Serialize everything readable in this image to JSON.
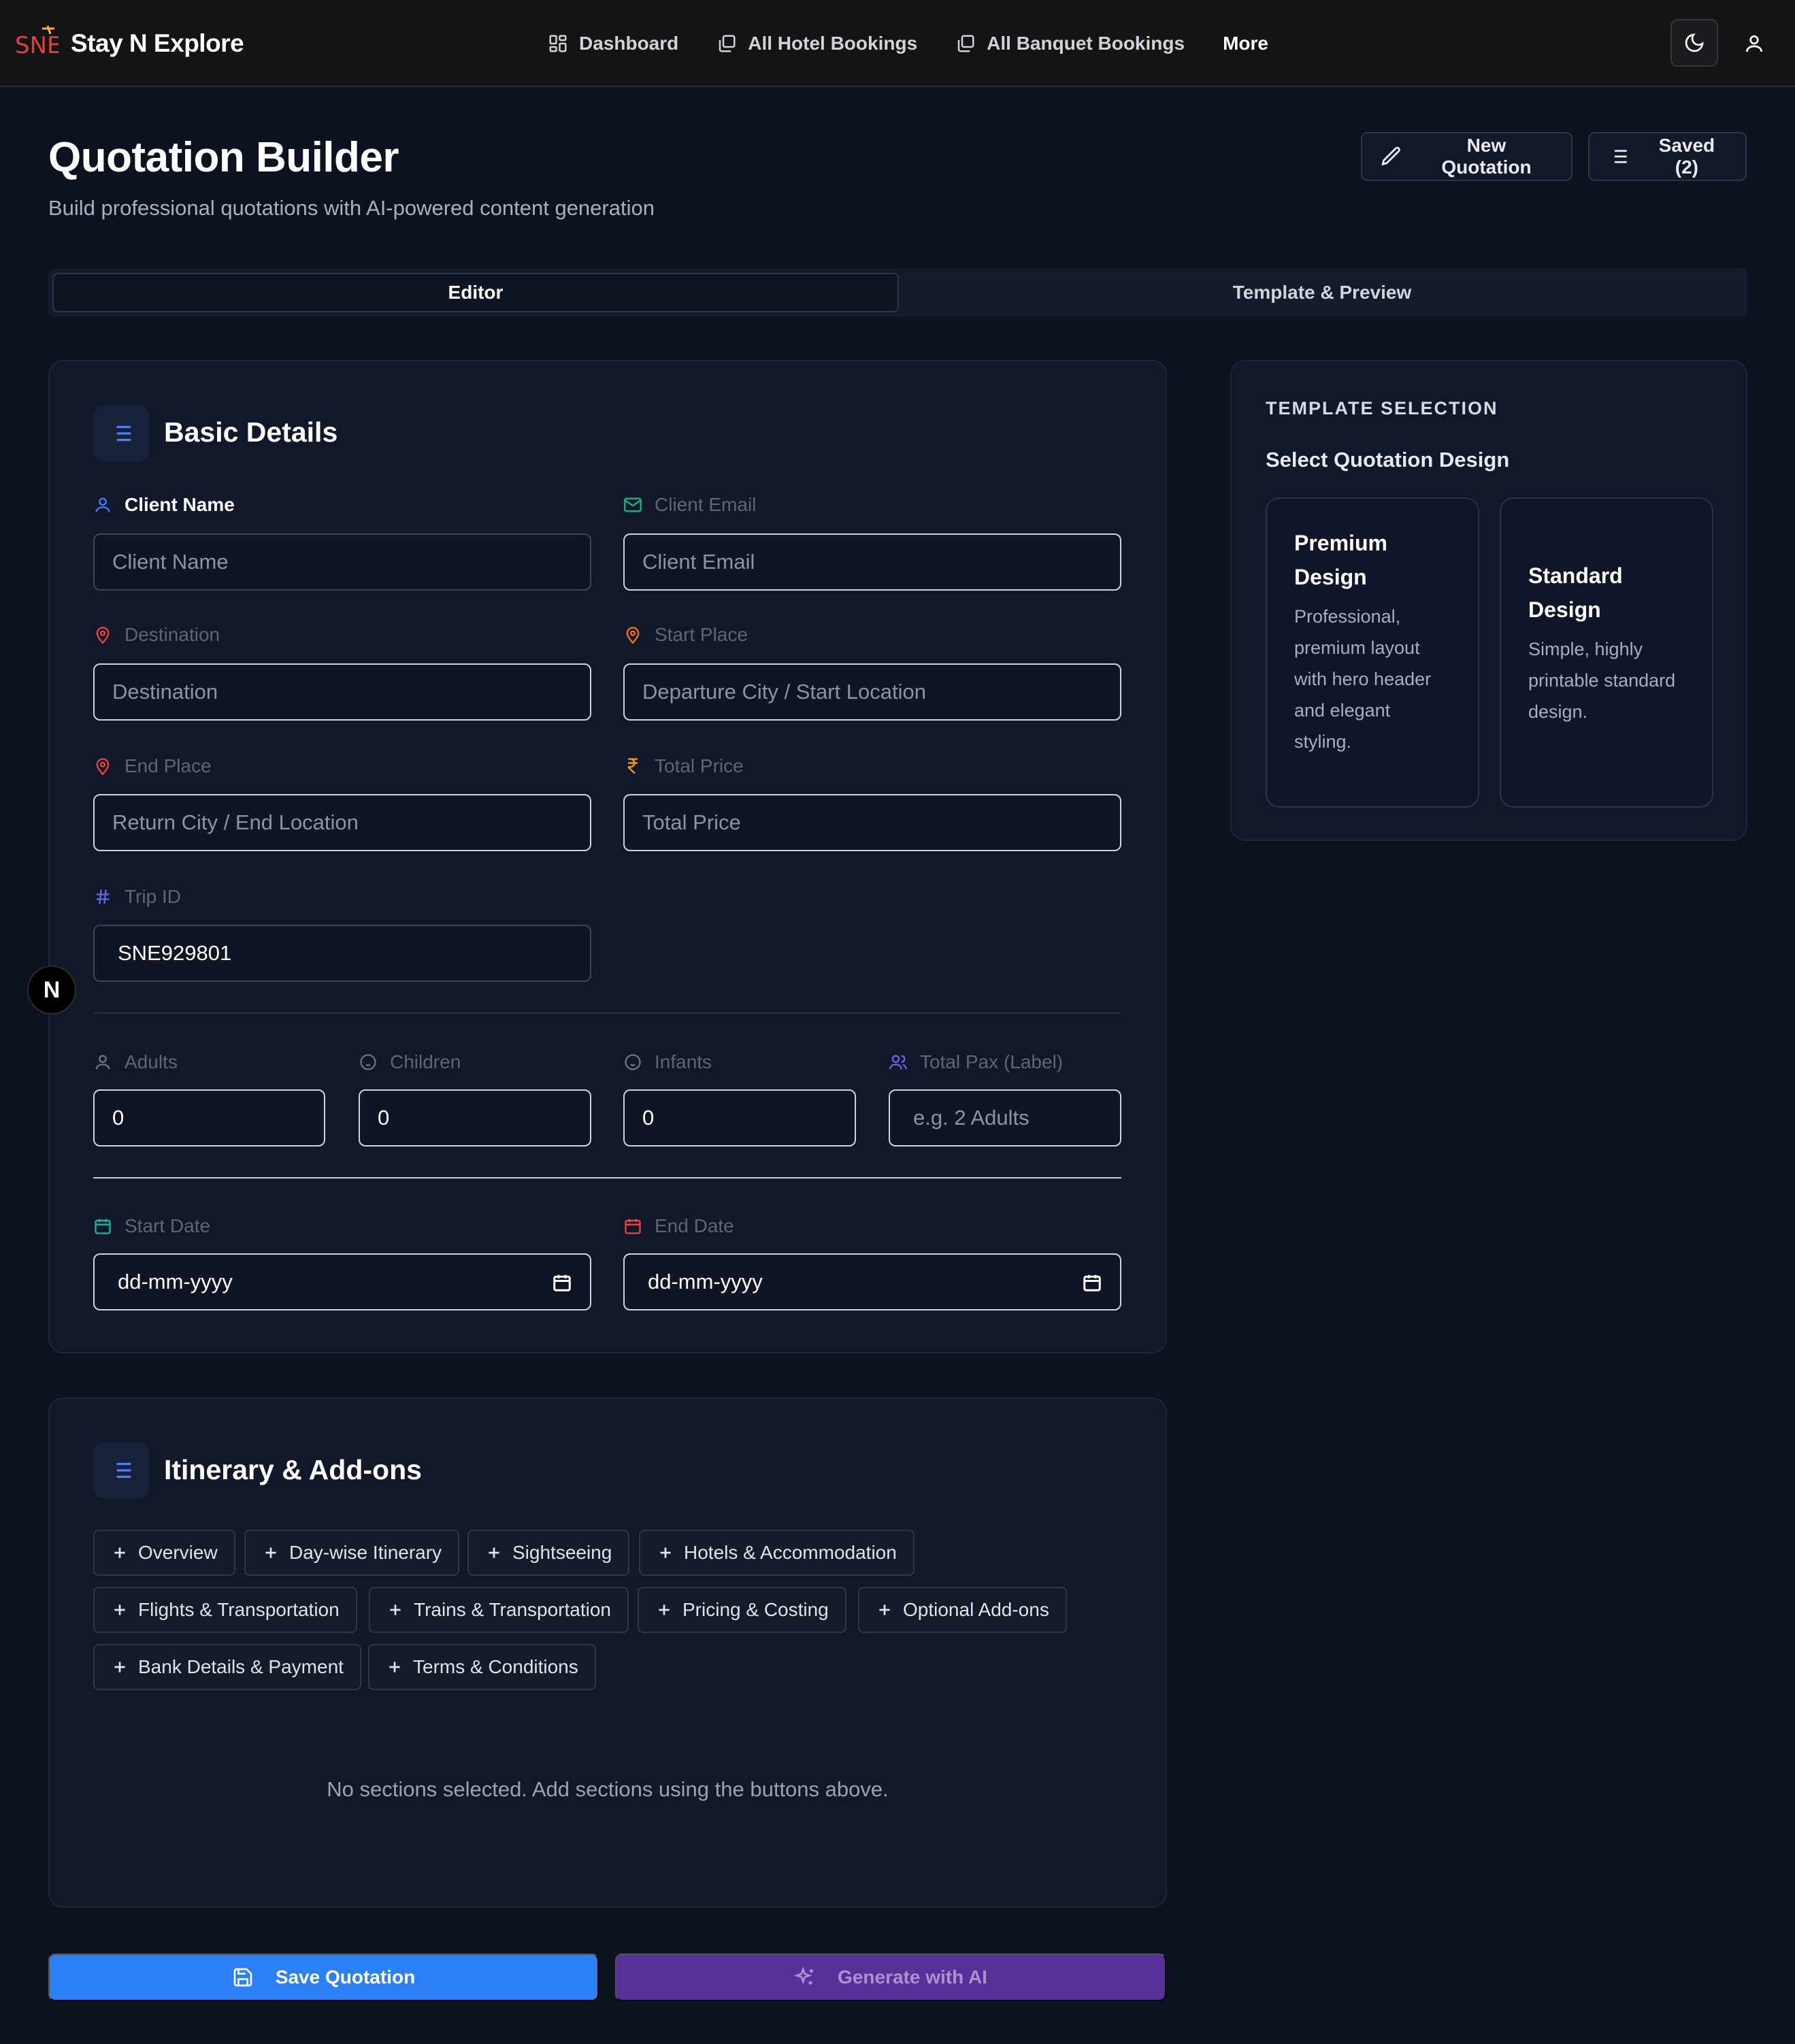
{
  "app": {
    "brand_mark": "SNE",
    "brand_name": "Stay N Explore"
  },
  "nav": {
    "items": [
      {
        "label": "Dashboard",
        "icon": "grid-icon"
      },
      {
        "label": "All Hotel Bookings",
        "icon": "copy-icon"
      },
      {
        "label": "All Banquet Bookings",
        "icon": "copy-icon"
      },
      {
        "label": "More",
        "icon": ""
      }
    ],
    "theme_toggle_icon": "moon-icon",
    "user_icon": "user-icon"
  },
  "header": {
    "title": "Quotation Builder",
    "subtitle": "Build professional quotations with AI-powered content generation",
    "new_label": "New Quotation",
    "saved_label": "Saved (2)"
  },
  "tabs": {
    "editor": "Editor",
    "preview": "Template & Preview",
    "active": "Editor"
  },
  "basic": {
    "title": "Basic Details",
    "client_name": {
      "label": "Client Name",
      "placeholder": "Client Name",
      "value": ""
    },
    "client_email": {
      "label": "Client Email",
      "placeholder": "Client Email",
      "value": ""
    },
    "destination": {
      "label": "Destination",
      "placeholder": "Destination",
      "value": ""
    },
    "start_place": {
      "label": "Start Place",
      "placeholder": "Departure City / Start Location",
      "value": ""
    },
    "end_place": {
      "label": "End Place",
      "placeholder": "Return City / End Location",
      "value": ""
    },
    "total_price": {
      "label": "Total Price",
      "placeholder": "Total Price",
      "value": ""
    },
    "trip_id": {
      "label": "Trip ID",
      "value": "SNE929801"
    },
    "adults": {
      "label": "Adults",
      "value": "0"
    },
    "children": {
      "label": "Children",
      "value": "0"
    },
    "infants": {
      "label": "Infants",
      "value": "0"
    },
    "total_pax": {
      "label": "Total Pax (Label)",
      "placeholder": "e.g. 2 Adults",
      "value": ""
    },
    "start_date": {
      "label": "Start Date",
      "placeholder": "dd-mm-yyyy"
    },
    "end_date": {
      "label": "End Date",
      "placeholder": "dd-mm-yyyy"
    }
  },
  "itinerary": {
    "title": "Itinerary & Add-ons",
    "chips": [
      "Overview",
      "Day-wise Itinerary",
      "Sightseeing",
      "Hotels & Accommodation",
      "Flights & Transportation",
      "Trains & Transportation",
      "Pricing & Costing",
      "Optional Add-ons",
      "Bank Details & Payment",
      "Terms & Conditions"
    ],
    "empty_message": "No sections selected. Add sections using the buttons above."
  },
  "template": {
    "eyebrow": "TEMPLATE SELECTION",
    "heading": "Select Quotation Design",
    "options": [
      {
        "name": "Premium Design",
        "description": "Professional, premium layout with hero header and elegant styling."
      },
      {
        "name": "Standard Design",
        "description": "Simple, highly printable standard design."
      }
    ]
  },
  "actions": {
    "save_label": "Save Quotation",
    "ai_label": "Generate with AI"
  },
  "floating_badge": "N",
  "colors": {
    "background": "#0d1220",
    "card": "#111829",
    "primary": "#2c80f5",
    "ai": "#58309a",
    "label_user": "#3b82f6",
    "label_email": "#10b981",
    "label_destination": "#ef4444",
    "label_start": "#f97316",
    "label_price": "#f59e0b",
    "label_trip": "#6366f1",
    "label_start_date": "#14b8a6",
    "label_end_date": "#ef4444"
  }
}
